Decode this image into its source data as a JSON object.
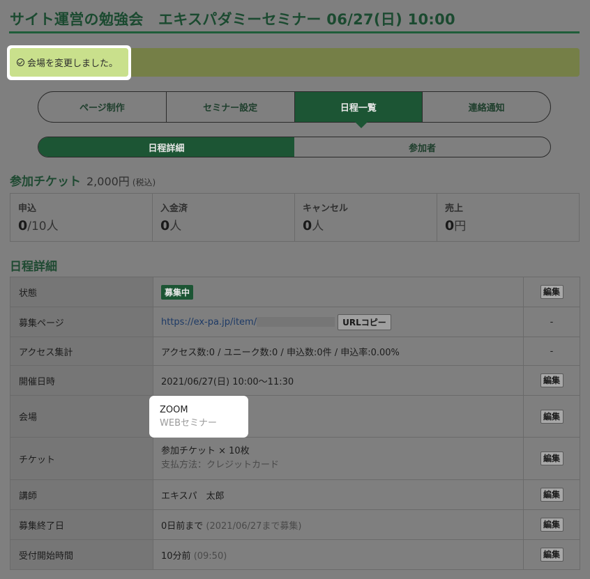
{
  "header": {
    "title": "サイト運営の勉強会　エキスパダミーセミナー 06/27(日) 10:00"
  },
  "alert": {
    "icon": "check-circle-icon",
    "message": "会場を変更しました。"
  },
  "main_tabs": [
    {
      "label": "ページ制作",
      "active": false
    },
    {
      "label": "セミナー設定",
      "active": false
    },
    {
      "label": "日程一覧",
      "active": true
    },
    {
      "label": "連絡通知",
      "active": false
    }
  ],
  "sub_tabs": [
    {
      "label": "日程詳細",
      "active": true
    },
    {
      "label": "参加者",
      "active": false
    }
  ],
  "ticket_section": {
    "title": "参加チケット",
    "price": "2,000円",
    "tax": "(税込)"
  },
  "stats": [
    {
      "label": "申込",
      "value": "0",
      "unit": "/10人"
    },
    {
      "label": "入金済",
      "value": "0",
      "unit": "人"
    },
    {
      "label": "キャンセル",
      "value": "0",
      "unit": "人"
    },
    {
      "label": "売上",
      "value": "0",
      "unit": "円"
    }
  ],
  "detail_section": {
    "title": "日程詳細"
  },
  "detail_rows": [
    {
      "key": "状態",
      "value": "募集中",
      "edit": "編集"
    },
    {
      "key": "募集ページ",
      "value": "https://ex-pa.jp/item/",
      "button": "URLコピー",
      "edit": "-"
    },
    {
      "key": "アクセス集計",
      "value": "アクセス数:0 / ユニーク数:0 / 申込数:0件 / 申込率:0.00%",
      "edit": "-"
    },
    {
      "key": "開催日時",
      "value": "2021/06/27(日) 10:00〜11:30",
      "edit": "編集"
    },
    {
      "key": "会場",
      "value": "ZOOM",
      "sub": "WEBセミナー",
      "edit": "編集"
    },
    {
      "key": "チケット",
      "value": "参加チケット × 10枚",
      "sub": "支払方法：クレジットカード",
      "edit": "編集"
    },
    {
      "key": "講師",
      "value": "エキスパ　太郎",
      "edit": "編集"
    },
    {
      "key": "募集終了日",
      "value": "0日前まで",
      "sub": "(2021/06/27まで募集)",
      "edit": "編集"
    },
    {
      "key": "受付開始時間",
      "value": "10分前",
      "sub": "(09:50)",
      "edit": "編集"
    }
  ]
}
